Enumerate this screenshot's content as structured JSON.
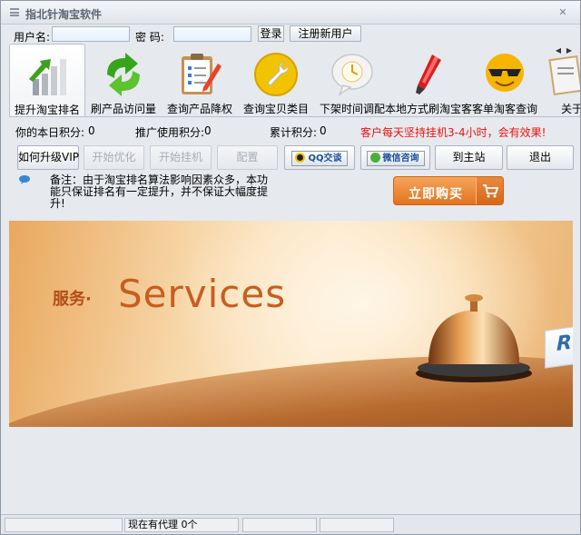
{
  "window": {
    "title": "指北针淘宝软件"
  },
  "login": {
    "username_label": "用户名:",
    "username_value": "",
    "password_label": "密  码:",
    "password_value": "",
    "login_button": "登录",
    "register_button": "注册新用户"
  },
  "toolbar": {
    "items": [
      {
        "label": "提升淘宝排名",
        "icon": "bar-chart-up-icon"
      },
      {
        "label": "刷产品访问量",
        "icon": "refresh-arrows-icon"
      },
      {
        "label": "查询产品降权",
        "icon": "clipboard-pencil-icon"
      },
      {
        "label": "查询宝贝类目",
        "icon": "wrench-icon"
      },
      {
        "label": "下架时间调配",
        "icon": "clock-bubble-icon"
      },
      {
        "label": "本地方式刷淘宝客",
        "icon": "marker-pen-icon"
      },
      {
        "label": "客单淘客查询",
        "icon": "sunglasses-face-icon"
      },
      {
        "label": "关于",
        "icon": "info-document-icon"
      }
    ],
    "scroll_left": "◀",
    "scroll_right": "▶"
  },
  "scores": {
    "today_label": "你的本日积分:",
    "today_value": "0",
    "promo_label": "推广使用积分:",
    "promo_value": "0",
    "total_label": "累计积分:",
    "total_value": "0",
    "notice": "客户每天坚持挂机3-4小时，会有效果!"
  },
  "actions": {
    "upgrade_vip": "如何升级VIP",
    "start_optimize": "开始优化",
    "start_hangup": "开始挂机",
    "config": "配置",
    "qq_chat": "QQ交谈",
    "wechat": "微信咨询",
    "home_site": "到主站",
    "exit": "退出"
  },
  "note": {
    "text": "备注：由于淘宝排名算法影响因素众多，本功能只保证排名有一定提升，并不保证大幅度提升!"
  },
  "buy": {
    "label": "立即购买"
  },
  "banner": {
    "title_cn": "服务·",
    "title_en": "Services",
    "sign_letter": "R"
  },
  "statusbar": {
    "agents": "现在有代理 0个",
    "cell2": "",
    "cell3": ""
  },
  "colors": {
    "notice_red": "#e8150e",
    "buy_orange": "#e2731e",
    "banner_text": "#c65e1f"
  }
}
